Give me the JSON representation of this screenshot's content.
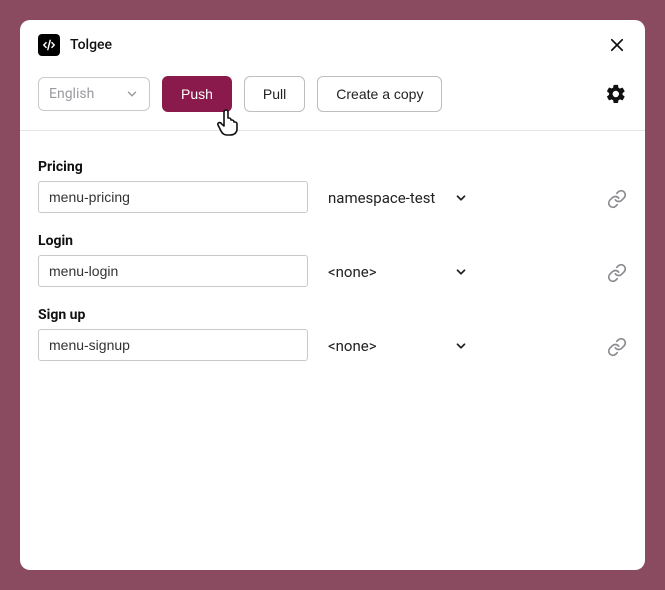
{
  "app": {
    "title": "Tolgee"
  },
  "toolbar": {
    "language": "English",
    "push_label": "Push",
    "pull_label": "Pull",
    "copy_label": "Create a copy"
  },
  "rows": [
    {
      "label": "Pricing",
      "key": "menu-pricing",
      "namespace": "namespace-test"
    },
    {
      "label": "Login",
      "key": "menu-login",
      "namespace": "<none>"
    },
    {
      "label": "Sign up",
      "key": "menu-signup",
      "namespace": "<none>"
    }
  ]
}
